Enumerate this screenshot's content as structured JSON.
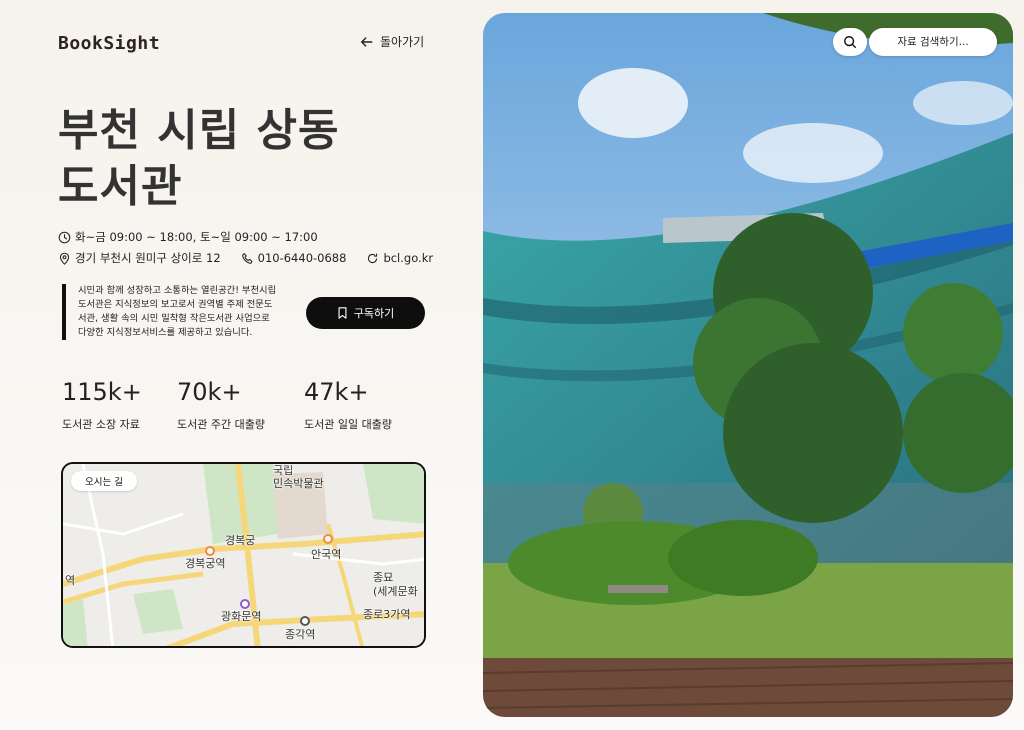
{
  "header": {
    "logo": "BookSight",
    "back_label": "돌아가기"
  },
  "library": {
    "title_line1": "부천 시립 상동",
    "title_line2": "도서관",
    "hours": "화~금 09:00 ~ 18:00, 토~일 09:00 ~ 17:00",
    "address": "경기 부천시 원미구 상이로 12",
    "phone": "010-6440-0688",
    "website": "bcl.go.kr",
    "description": "시민과 함께 성장하고 소통하는 열린공간! 부천시립도서관은 지식정보의 보고로서 권역별 주제 전문도서관, 생활 속의 시민 밀착형 작은도서관 사업으로 다양한 지식정보서비스를 제공하고 있습니다.",
    "subscribe_label": "구독하기"
  },
  "stats": [
    {
      "value": "115k+",
      "label": "도서관 소장 자료"
    },
    {
      "value": "70k+",
      "label": "도서관 주간 대출량"
    },
    {
      "value": "47k+",
      "label": "도서관 일일 대출량"
    }
  ],
  "map": {
    "chip": "오시는 길",
    "labels": {
      "museum": "국립\n민속박물관",
      "palace": "경복궁",
      "palace_station": "경복궁역",
      "anguk": "안국역",
      "gwanghwamun": "광화문역",
      "jonggak": "종각역",
      "jongno3": "종로3가역",
      "jongmyo": "종묘\n(세계문화",
      "left_station": "역"
    }
  },
  "search": {
    "placeholder": "자료 검색하기..."
  },
  "colors": {
    "primary": "#0e0e0e",
    "background": "#f6f2ec"
  }
}
